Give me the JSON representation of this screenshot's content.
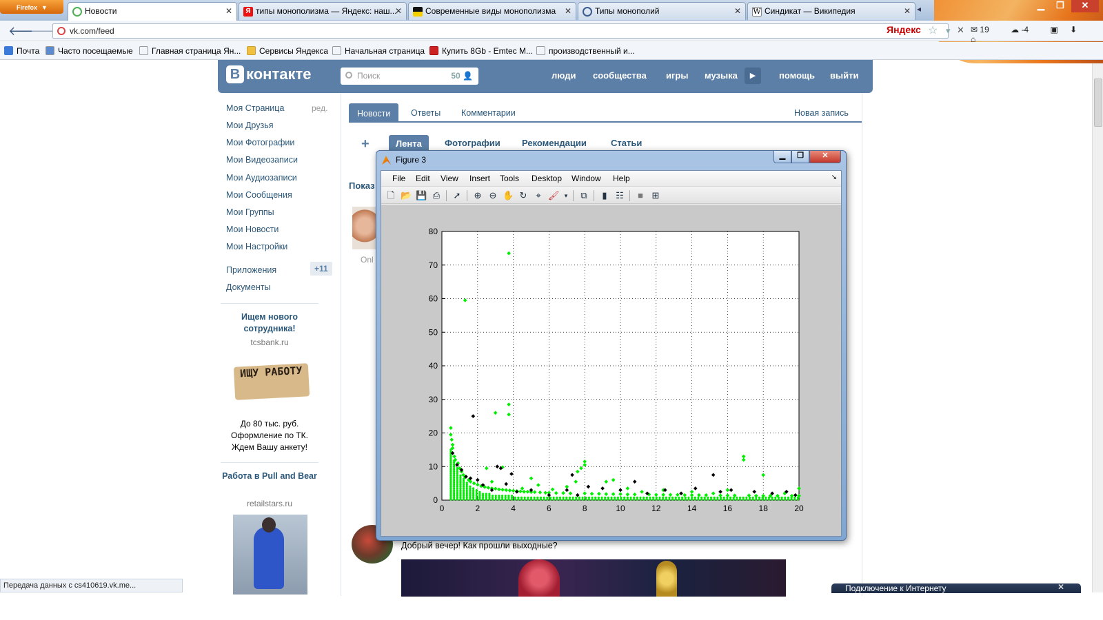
{
  "browser": {
    "app_button": "Firefox",
    "tabs": [
      {
        "label": "Новости",
        "active": true
      },
      {
        "label": "типы монополизма — Яндекс: наш..."
      },
      {
        "label": "Современные виды монополизма"
      },
      {
        "label": "Типы монополий"
      },
      {
        "label": "Синдикат — Википедия"
      }
    ],
    "url": "vk.com/feed",
    "search_engine": "Яндекс",
    "mail_count": "19",
    "weather": "-4",
    "bookmarks": [
      "Почта",
      "Часто посещаемые",
      "Главная страница Ян...",
      "Сервисы Яндекса",
      "Начальная страница",
      "Купить 8Gb - Emtec M...",
      "производственный и..."
    ],
    "status_text": "Передача данных с cs410619.vk.me..."
  },
  "vk": {
    "logo": "контакте",
    "logo_letter": "В",
    "search_placeholder": "Поиск",
    "search_count": "50",
    "nav": [
      "люди",
      "сообщества",
      "игры",
      "музыка",
      "помощь",
      "выйти"
    ],
    "sidebar": {
      "items": [
        "Моя Страница",
        "Мои Друзья",
        "Мои Фотографии",
        "Мои Видеозаписи",
        "Мои Аудиозаписи",
        "Мои Сообщения",
        "Мои Группы",
        "Мои Новости",
        "Мои Настройки"
      ],
      "edit": "ред.",
      "apps": "Приложения",
      "apps_count": "+11",
      "docs": "Документы"
    },
    "ads": [
      {
        "title": "Ищем нового сотрудника!",
        "domain": "tcsbank.ru",
        "sign": "ИЩУ РАБОТУ",
        "text": [
          "До 80 тыс. руб.",
          "Оформление по ТК.",
          "Ждем Вашу анкету!"
        ]
      },
      {
        "title": "Работа в Pull and Bear",
        "domain": "retailstars.ru"
      }
    ],
    "tabs1": [
      "Новости",
      "Ответы",
      "Комментарии"
    ],
    "new_post": "Новая запись",
    "tabs2": [
      "Лента",
      "Фотографии",
      "Рекомендации",
      "Статьи"
    ],
    "pokaz": "Показ",
    "online": "Onl",
    "post_text": "Добрый вечер! Как прошли выходные?",
    "notification": "Подключение к Интернету"
  },
  "figure": {
    "title": "Figure 3",
    "menu": [
      "File",
      "Edit",
      "View",
      "Insert",
      "Tools",
      "Desktop",
      "Window",
      "Help"
    ]
  },
  "chart_data": {
    "type": "scatter",
    "title": "",
    "xlabel": "",
    "ylabel": "",
    "xlim": [
      0,
      20
    ],
    "ylim": [
      0,
      80
    ],
    "xticks": [
      0,
      2,
      4,
      6,
      8,
      10,
      12,
      14,
      16,
      18,
      20
    ],
    "yticks": [
      0,
      10,
      20,
      30,
      40,
      50,
      60,
      70,
      80
    ],
    "grid": true,
    "colors": {
      "green": "#00ee00",
      "black": "#000000"
    },
    "series": [
      {
        "color": "green",
        "points": [
          [
            0.5,
            21.5
          ],
          [
            0.5,
            19.5
          ],
          [
            0.55,
            18
          ],
          [
            0.6,
            16.5
          ],
          [
            0.6,
            15.5
          ],
          [
            0.7,
            13
          ],
          [
            0.75,
            12
          ],
          [
            0.9,
            11
          ],
          [
            1.0,
            9.5
          ],
          [
            1.1,
            8.5
          ],
          [
            1.2,
            7.5
          ],
          [
            1.3,
            6.8
          ],
          [
            1.3,
            59.5
          ],
          [
            1.5,
            6
          ],
          [
            1.6,
            5.5
          ],
          [
            1.8,
            5
          ],
          [
            2.0,
            4.6
          ],
          [
            2.2,
            4.2
          ],
          [
            2.4,
            3.9
          ],
          [
            2.5,
            9.5
          ],
          [
            2.6,
            3.7
          ],
          [
            2.8,
            3.5
          ],
          [
            2.8,
            5.5
          ],
          [
            3.0,
            3.4
          ],
          [
            3.0,
            26
          ],
          [
            3.2,
            3.2
          ],
          [
            3.4,
            3.1
          ],
          [
            3.4,
            9.8
          ],
          [
            3.6,
            3.0
          ],
          [
            3.75,
            73.5
          ],
          [
            3.75,
            28.5
          ],
          [
            3.75,
            25.5
          ],
          [
            3.8,
            2.9
          ],
          [
            4.0,
            2.8
          ],
          [
            4.2,
            2.7
          ],
          [
            4.4,
            2.6
          ],
          [
            4.5,
            3.5
          ],
          [
            4.6,
            2.5
          ],
          [
            4.8,
            2.5
          ],
          [
            5.0,
            6.5
          ],
          [
            5.0,
            2.4
          ],
          [
            5.2,
            2.4
          ],
          [
            5.4,
            4.5
          ],
          [
            5.5,
            2.3
          ],
          [
            5.8,
            2.2
          ],
          [
            6.0,
            2.2
          ],
          [
            6.2,
            3.2
          ],
          [
            6.4,
            2.1
          ],
          [
            6.8,
            2.1
          ],
          [
            7.0,
            4
          ],
          [
            7.2,
            2.0
          ],
          [
            7.5,
            5.5
          ],
          [
            7.6,
            8.5
          ],
          [
            7.8,
            9.5
          ],
          [
            8.0,
            11.5
          ],
          [
            8.0,
            10.5
          ],
          [
            8.0,
            2.0
          ],
          [
            8.4,
            1.9
          ],
          [
            8.8,
            1.9
          ],
          [
            9.2,
            5.5
          ],
          [
            9.2,
            1.8
          ],
          [
            9.6,
            6
          ],
          [
            9.6,
            1.8
          ],
          [
            10.0,
            1.8
          ],
          [
            10.4,
            3.5
          ],
          [
            10.4,
            1.7
          ],
          [
            10.8,
            1.7
          ],
          [
            11.2,
            2.5
          ],
          [
            11.6,
            1.7
          ],
          [
            12.0,
            1.6
          ],
          [
            12.4,
            3
          ],
          [
            12.4,
            1.6
          ],
          [
            12.8,
            1.6
          ],
          [
            13.2,
            1.6
          ],
          [
            13.6,
            1.5
          ],
          [
            14.0,
            2.5
          ],
          [
            14.0,
            1.5
          ],
          [
            14.4,
            1.5
          ],
          [
            14.8,
            1.5
          ],
          [
            15.2,
            2
          ],
          [
            15.6,
            1.4
          ],
          [
            16.0,
            3
          ],
          [
            16.0,
            1.4
          ],
          [
            16.4,
            1.4
          ],
          [
            16.9,
            13
          ],
          [
            16.9,
            12
          ],
          [
            17.2,
            1.4
          ],
          [
            17.6,
            1.3
          ],
          [
            18.0,
            7.5
          ],
          [
            18.0,
            1.3
          ],
          [
            18.4,
            1.3
          ],
          [
            18.8,
            1.3
          ],
          [
            19.2,
            2
          ],
          [
            19.6,
            1.3
          ],
          [
            20.0,
            3.5
          ],
          [
            20.0,
            1.3
          ]
        ]
      },
      {
        "color": "black",
        "points": [
          [
            0.6,
            14
          ],
          [
            0.85,
            10.5
          ],
          [
            1.1,
            9
          ],
          [
            1.35,
            7
          ],
          [
            1.6,
            6.5
          ],
          [
            1.75,
            25
          ],
          [
            2.0,
            6
          ],
          [
            2.3,
            4.5
          ],
          [
            2.8,
            3
          ],
          [
            3.1,
            10
          ],
          [
            3.3,
            9.5
          ],
          [
            3.6,
            4.8
          ],
          [
            3.9,
            7.8
          ],
          [
            4.2,
            2.5
          ],
          [
            5.0,
            3
          ],
          [
            6.0,
            1.5
          ],
          [
            7.0,
            3
          ],
          [
            7.3,
            7.5
          ],
          [
            7.6,
            1.5
          ],
          [
            8.2,
            4
          ],
          [
            9.0,
            3.5
          ],
          [
            10.0,
            3
          ],
          [
            10.8,
            5.5
          ],
          [
            11.5,
            2
          ],
          [
            12.5,
            3
          ],
          [
            13.4,
            2
          ],
          [
            14.2,
            3.5
          ],
          [
            15.2,
            7.5
          ],
          [
            15.6,
            2.5
          ],
          [
            16.2,
            3
          ],
          [
            17.5,
            2.5
          ],
          [
            18.5,
            2
          ],
          [
            19.3,
            2.5
          ],
          [
            19.8,
            1.5
          ]
        ]
      }
    ]
  }
}
